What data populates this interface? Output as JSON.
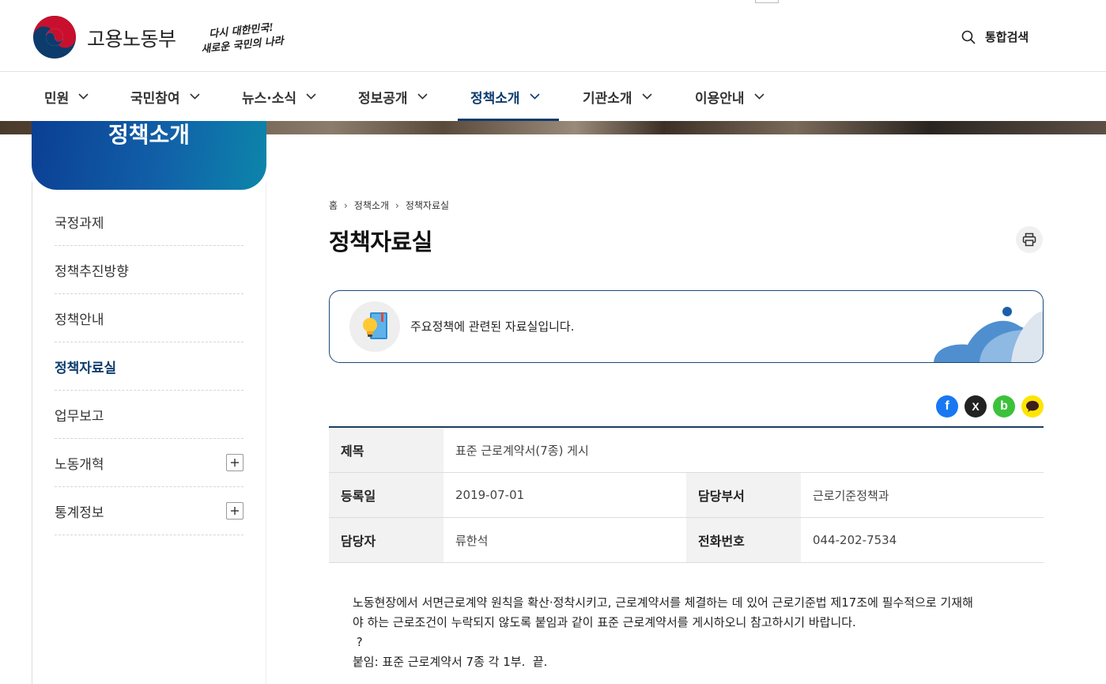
{
  "header": {
    "org_name": "고용노동부",
    "slogan_line1": "다시 대한민국!",
    "slogan_line2": "새로운 국민의 나라",
    "search_label": "통합검색"
  },
  "gnb": [
    {
      "label": "민원"
    },
    {
      "label": "국민참여"
    },
    {
      "label": "뉴스·소식"
    },
    {
      "label": "정보공개"
    },
    {
      "label": "정책소개",
      "active": true
    },
    {
      "label": "기관소개"
    },
    {
      "label": "이용안내"
    }
  ],
  "lnb": {
    "title": "정책소개",
    "items": [
      {
        "label": "국정과제"
      },
      {
        "label": "정책추진방향"
      },
      {
        "label": "정책안내"
      },
      {
        "label": "정책자료실",
        "active": true
      },
      {
        "label": "업무보고"
      },
      {
        "label": "노동개혁",
        "expandable": true
      },
      {
        "label": "통계정보",
        "expandable": true
      }
    ]
  },
  "breadcrumb": [
    "홈",
    "정책소개",
    "정책자료실"
  ],
  "page_title": "정책자료실",
  "intro_text": "주요정책에 관련된 자료실입니다.",
  "share": {
    "facebook": "f",
    "x": "X",
    "band": "b",
    "kakao": "kakao"
  },
  "info": {
    "title_label": "제목",
    "title_value": "표준 근로계약서(7종) 게시",
    "date_label": "등록일",
    "date_value": "2019-07-01",
    "dept_label": "담당부서",
    "dept_value": "근로기준정책과",
    "manager_label": "담당자",
    "manager_value": "류한석",
    "phone_label": "전화번호",
    "phone_value": "044-202-7534"
  },
  "body": {
    "line1": "노동현장에서 서면근로계약 원칙을 확산·정착시키고, 근로계약서를 체결하는 데 있어 근로기준법 제17조에 필수적으로 기재해",
    "line2": "야 하는 근로조건이 누락되지 않도록 붙임과 같이 표준 근로계약서를 게시하오니 참고하시기 바랍니다.",
    "line3": " ?",
    "line4": "붙임: 표준 근로계약서 7종 각 1부.  끝."
  },
  "colors": {
    "brand_navy": "#0c3b6c",
    "brand_blue": "#1160a8",
    "logo_red": "#c8102e"
  }
}
